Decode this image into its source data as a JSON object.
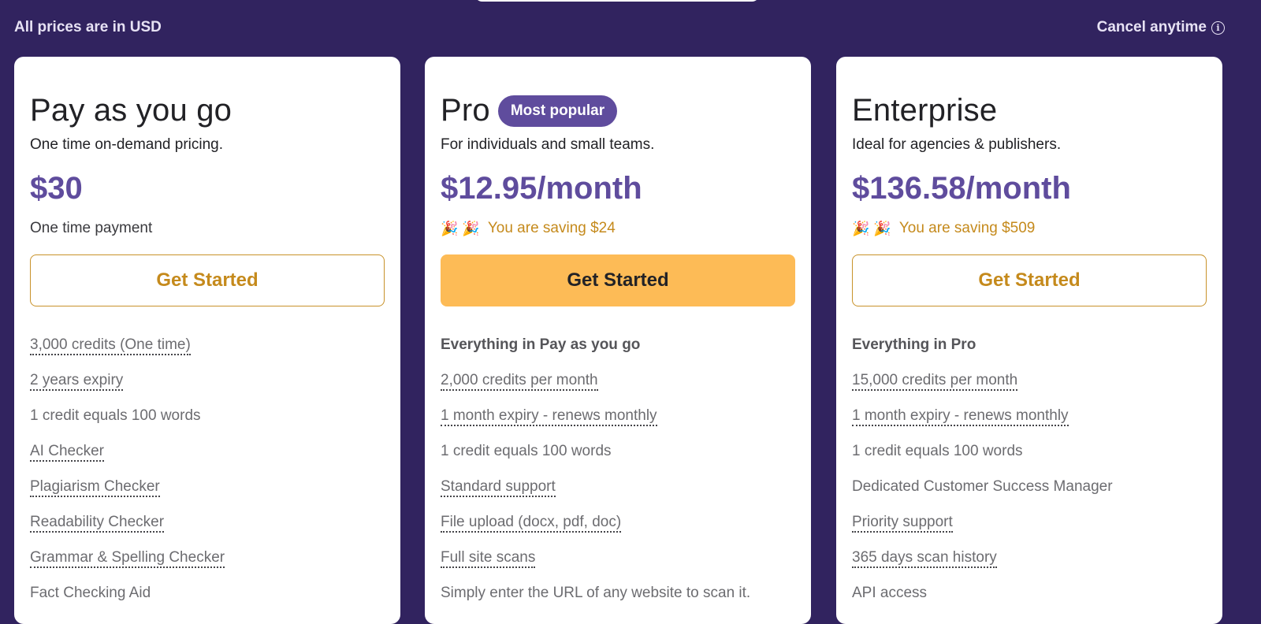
{
  "header": {
    "prices_note": "All prices are in USD",
    "cancel_note": "Cancel anytime",
    "cancel_icon": "info-icon"
  },
  "colors": {
    "background": "#31235f",
    "accent_purple": "#5f4c9d",
    "accent_gold": "#c58a1c",
    "cta_filled": "#fdbb56"
  },
  "plans": [
    {
      "name": "Pay as you go",
      "description": "One time on-demand pricing.",
      "price": "$30",
      "subline": "One time payment",
      "cta_label": "Get Started",
      "cta_style": "outline",
      "features": [
        {
          "text": "3,000 credits (One time)",
          "underline": true
        },
        {
          "text": "2 years expiry",
          "underline": true
        },
        {
          "text": "1 credit equals 100 words",
          "underline": false
        },
        {
          "text": "AI Checker",
          "underline": true
        },
        {
          "text": "Plagiarism Checker",
          "underline": true
        },
        {
          "text": "Readability Checker",
          "underline": true
        },
        {
          "text": "Grammar & Spelling Checker",
          "underline": true
        },
        {
          "text": "Fact Checking Aid",
          "underline": false
        }
      ]
    },
    {
      "name": "Pro",
      "badge": "Most popular",
      "description": "For individuals and small teams.",
      "price": "$12.95/month",
      "subline": "You are saving $24",
      "subline_icons": "🎉 🎉",
      "cta_label": "Get Started",
      "cta_style": "filled",
      "features_heading": "Everything in Pay as you go",
      "features": [
        {
          "text": "2,000 credits per month",
          "underline": true
        },
        {
          "text": "1 month expiry - renews monthly",
          "underline": true
        },
        {
          "text": "1 credit equals 100 words",
          "underline": false
        },
        {
          "text": "Standard support",
          "underline": true
        },
        {
          "text": "File upload (docx, pdf, doc)",
          "underline": true
        },
        {
          "text": "Full site scans",
          "underline": true
        },
        {
          "text": "Simply enter the URL of any website to scan it.",
          "underline": false
        }
      ]
    },
    {
      "name": "Enterprise",
      "description": "Ideal for agencies & publishers.",
      "price": "$136.58/month",
      "subline": "You are saving $509",
      "subline_icons": "🎉 🎉",
      "cta_label": "Get Started",
      "cta_style": "outline",
      "features_heading": "Everything in Pro",
      "features": [
        {
          "text": "15,000 credits per month",
          "underline": true
        },
        {
          "text": "1 month expiry - renews monthly",
          "underline": true
        },
        {
          "text": "1 credit equals 100 words",
          "underline": false
        },
        {
          "text": "Dedicated Customer Success Manager",
          "underline": false
        },
        {
          "text": "Priority support",
          "underline": true
        },
        {
          "text": "365 days scan history",
          "underline": true
        },
        {
          "text": "API access",
          "underline": false
        }
      ]
    }
  ]
}
